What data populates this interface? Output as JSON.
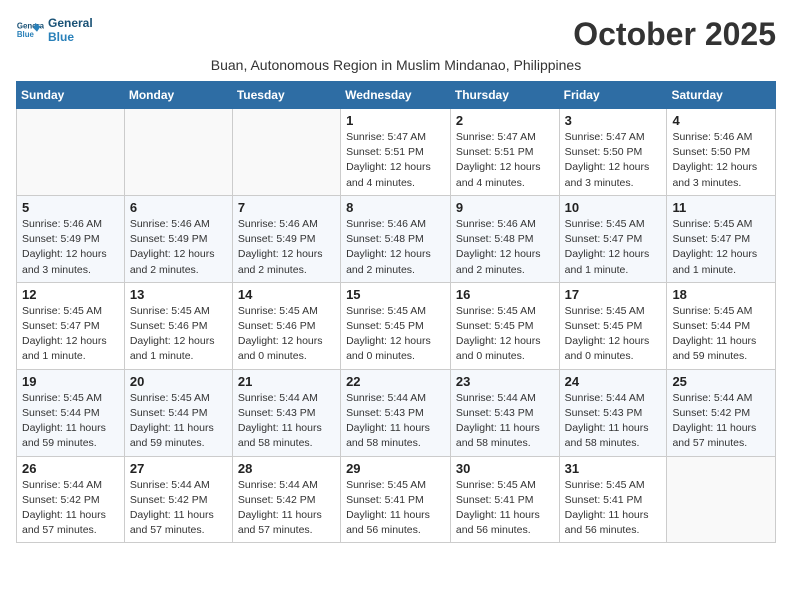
{
  "header": {
    "logo_line1": "General",
    "logo_line2": "Blue",
    "month_title": "October 2025",
    "subtitle": "Buan, Autonomous Region in Muslim Mindanao, Philippines"
  },
  "weekdays": [
    "Sunday",
    "Monday",
    "Tuesday",
    "Wednesday",
    "Thursday",
    "Friday",
    "Saturday"
  ],
  "weeks": [
    [
      {
        "day": "",
        "info": ""
      },
      {
        "day": "",
        "info": ""
      },
      {
        "day": "",
        "info": ""
      },
      {
        "day": "1",
        "info": "Sunrise: 5:47 AM\nSunset: 5:51 PM\nDaylight: 12 hours and 4 minutes."
      },
      {
        "day": "2",
        "info": "Sunrise: 5:47 AM\nSunset: 5:51 PM\nDaylight: 12 hours and 4 minutes."
      },
      {
        "day": "3",
        "info": "Sunrise: 5:47 AM\nSunset: 5:50 PM\nDaylight: 12 hours and 3 minutes."
      },
      {
        "day": "4",
        "info": "Sunrise: 5:46 AM\nSunset: 5:50 PM\nDaylight: 12 hours and 3 minutes."
      }
    ],
    [
      {
        "day": "5",
        "info": "Sunrise: 5:46 AM\nSunset: 5:49 PM\nDaylight: 12 hours and 3 minutes."
      },
      {
        "day": "6",
        "info": "Sunrise: 5:46 AM\nSunset: 5:49 PM\nDaylight: 12 hours and 2 minutes."
      },
      {
        "day": "7",
        "info": "Sunrise: 5:46 AM\nSunset: 5:49 PM\nDaylight: 12 hours and 2 minutes."
      },
      {
        "day": "8",
        "info": "Sunrise: 5:46 AM\nSunset: 5:48 PM\nDaylight: 12 hours and 2 minutes."
      },
      {
        "day": "9",
        "info": "Sunrise: 5:46 AM\nSunset: 5:48 PM\nDaylight: 12 hours and 2 minutes."
      },
      {
        "day": "10",
        "info": "Sunrise: 5:45 AM\nSunset: 5:47 PM\nDaylight: 12 hours and 1 minute."
      },
      {
        "day": "11",
        "info": "Sunrise: 5:45 AM\nSunset: 5:47 PM\nDaylight: 12 hours and 1 minute."
      }
    ],
    [
      {
        "day": "12",
        "info": "Sunrise: 5:45 AM\nSunset: 5:47 PM\nDaylight: 12 hours and 1 minute."
      },
      {
        "day": "13",
        "info": "Sunrise: 5:45 AM\nSunset: 5:46 PM\nDaylight: 12 hours and 1 minute."
      },
      {
        "day": "14",
        "info": "Sunrise: 5:45 AM\nSunset: 5:46 PM\nDaylight: 12 hours and 0 minutes."
      },
      {
        "day": "15",
        "info": "Sunrise: 5:45 AM\nSunset: 5:45 PM\nDaylight: 12 hours and 0 minutes."
      },
      {
        "day": "16",
        "info": "Sunrise: 5:45 AM\nSunset: 5:45 PM\nDaylight: 12 hours and 0 minutes."
      },
      {
        "day": "17",
        "info": "Sunrise: 5:45 AM\nSunset: 5:45 PM\nDaylight: 12 hours and 0 minutes."
      },
      {
        "day": "18",
        "info": "Sunrise: 5:45 AM\nSunset: 5:44 PM\nDaylight: 11 hours and 59 minutes."
      }
    ],
    [
      {
        "day": "19",
        "info": "Sunrise: 5:45 AM\nSunset: 5:44 PM\nDaylight: 11 hours and 59 minutes."
      },
      {
        "day": "20",
        "info": "Sunrise: 5:45 AM\nSunset: 5:44 PM\nDaylight: 11 hours and 59 minutes."
      },
      {
        "day": "21",
        "info": "Sunrise: 5:44 AM\nSunset: 5:43 PM\nDaylight: 11 hours and 58 minutes."
      },
      {
        "day": "22",
        "info": "Sunrise: 5:44 AM\nSunset: 5:43 PM\nDaylight: 11 hours and 58 minutes."
      },
      {
        "day": "23",
        "info": "Sunrise: 5:44 AM\nSunset: 5:43 PM\nDaylight: 11 hours and 58 minutes."
      },
      {
        "day": "24",
        "info": "Sunrise: 5:44 AM\nSunset: 5:43 PM\nDaylight: 11 hours and 58 minutes."
      },
      {
        "day": "25",
        "info": "Sunrise: 5:44 AM\nSunset: 5:42 PM\nDaylight: 11 hours and 57 minutes."
      }
    ],
    [
      {
        "day": "26",
        "info": "Sunrise: 5:44 AM\nSunset: 5:42 PM\nDaylight: 11 hours and 57 minutes."
      },
      {
        "day": "27",
        "info": "Sunrise: 5:44 AM\nSunset: 5:42 PM\nDaylight: 11 hours and 57 minutes."
      },
      {
        "day": "28",
        "info": "Sunrise: 5:44 AM\nSunset: 5:42 PM\nDaylight: 11 hours and 57 minutes."
      },
      {
        "day": "29",
        "info": "Sunrise: 5:45 AM\nSunset: 5:41 PM\nDaylight: 11 hours and 56 minutes."
      },
      {
        "day": "30",
        "info": "Sunrise: 5:45 AM\nSunset: 5:41 PM\nDaylight: 11 hours and 56 minutes."
      },
      {
        "day": "31",
        "info": "Sunrise: 5:45 AM\nSunset: 5:41 PM\nDaylight: 11 hours and 56 minutes."
      },
      {
        "day": "",
        "info": ""
      }
    ]
  ]
}
